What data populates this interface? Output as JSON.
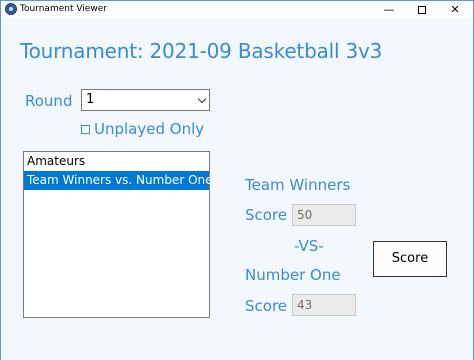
{
  "window": {
    "title": "Tournament Viewer",
    "minimize": "—",
    "close": "✕"
  },
  "heading": "Tournament: 2021-09 Basketball 3v3",
  "round": {
    "label": "Round",
    "selected": "1"
  },
  "unplayed": {
    "label": "Unplayed Only",
    "checked": false
  },
  "matchups": {
    "items": [
      "Amateurs",
      "Team Winners vs. Number One"
    ],
    "selected_index": 1
  },
  "team_one": {
    "name": "Team Winners",
    "score_label": "Score",
    "score": "50"
  },
  "vs_text": "-VS-",
  "team_two": {
    "name": "Number One",
    "score_label": "Score",
    "score": "43"
  },
  "score_button": "Score",
  "colors": {
    "accent": "#3b8ad4",
    "selection": "#0078d7",
    "background": "#f2f8fd"
  }
}
